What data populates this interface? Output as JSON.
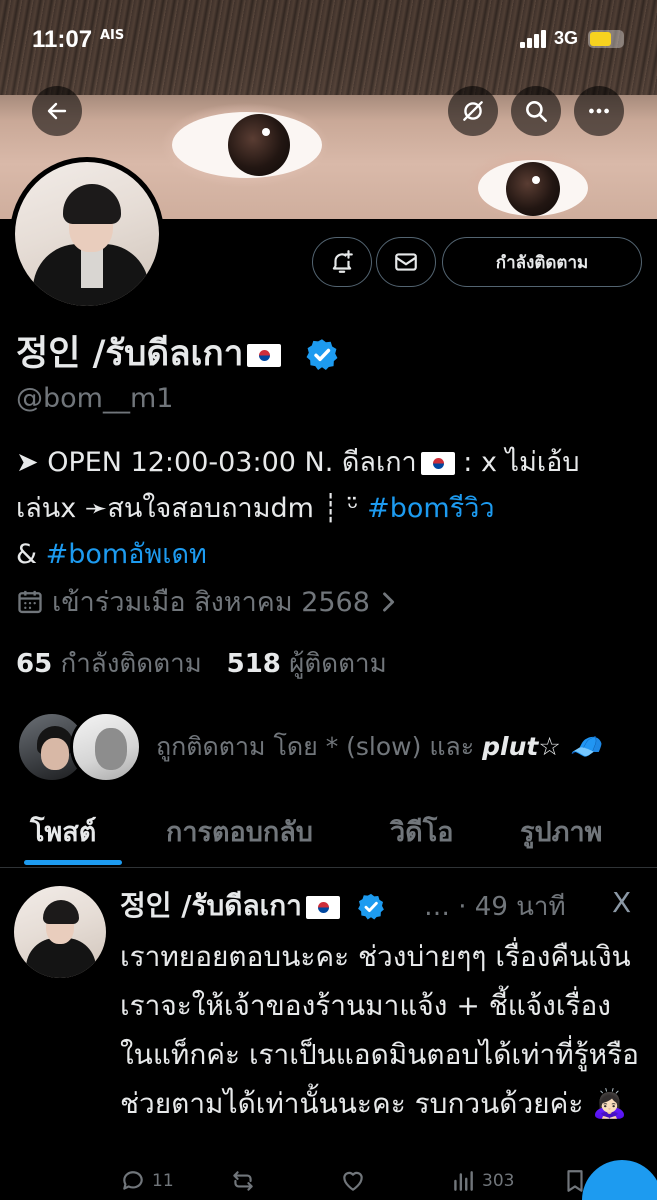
{
  "status_bar": {
    "time": "11:07",
    "carrier_tag": "AIS",
    "network": "3G",
    "battery_level": 0.65
  },
  "header": {
    "back_icon": "back-arrow-icon",
    "hide_icon": "eye-off-icon",
    "search_icon": "search-icon",
    "more_icon": "more-icon"
  },
  "profile": {
    "name": "정인 /รับดีลเกา",
    "flag": "🇰🇷",
    "handle": "@bom__m1",
    "bio_line1": "➤ OPEN 12:00-03:00 N. ดีลเกา",
    "bio_line1_end": " : x ไม่เอ้บ",
    "bio_line2": "เล่นx ➛สนใจสอบถามdm ┊ ᵕ̈ ",
    "bio_tag1": "#bomรีวิว",
    "bio_line3": "& ",
    "bio_tag2": "#bomอัพเดท",
    "joined": "เข้าร่วมเมือ สิงหาคม 2568",
    "following_count": "65",
    "following_label": "กำลังติดตาม",
    "followers_count": "518",
    "followers_label": "ผู้ติดตาม",
    "followed_by_prefix": "ถูกติดตาม โดย * (slow) และ ",
    "followed_by_name": "plut☆ 🧢",
    "follow_button": "กำลังติดตาม"
  },
  "tabs": [
    {
      "label": "โพสต์"
    },
    {
      "label": "การตอบกลับ"
    },
    {
      "label": "วิดีโอ"
    },
    {
      "label": "รูปภาพ"
    }
  ],
  "post": {
    "author": "정인 /รับดีลเกา",
    "meta": "… · 49 นาที",
    "x_icon": "X",
    "text": "เราทยอยตอบนะคะ ช่วงบ่ายๆๆ เรื่องคืนเงิน เราจะให้เจ้าของร้านมาแจ้ง + ชี้แจ้งเรื่อง ในแท็กค่ะ เราเป็นแอดมินตอบได้เท่าที่รู้หรือช่วยตามได้เท่านั้นนะคะ รบกวนด้วยค่ะ 🙇🏻‍♀️",
    "replies": "11",
    "views": "303"
  },
  "colors": {
    "accent": "#1d9bf0",
    "muted": "#71767b",
    "text": "#e7e9ea",
    "background": "#000000"
  }
}
